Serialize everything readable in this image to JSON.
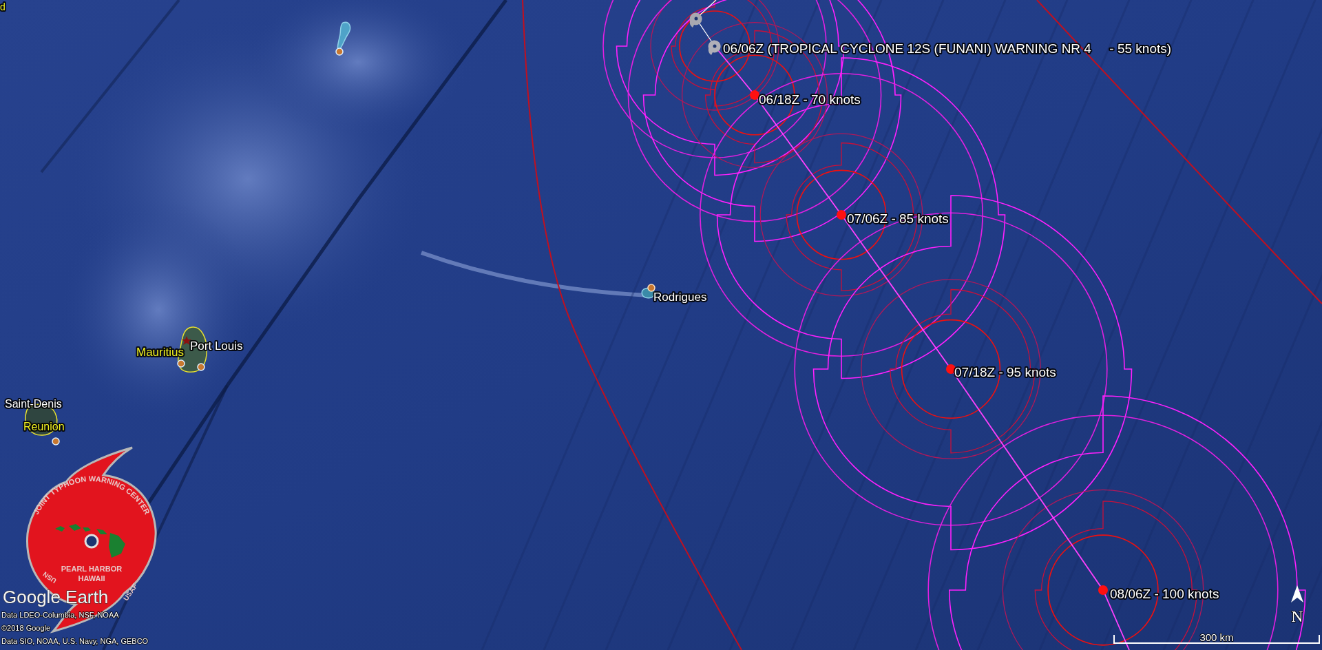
{
  "places": [
    {
      "name": "d",
      "kind": "country"
    },
    {
      "name": "Rodrigues",
      "kind": "city"
    },
    {
      "name": "Port Louis",
      "kind": "city"
    },
    {
      "name": "Mauritius",
      "kind": "country"
    },
    {
      "name": "Saint-Denis",
      "kind": "city"
    },
    {
      "name": "Reunion",
      "kind": "country"
    }
  ],
  "track": [
    {
      "label": "06/06Z (TROPICAL CYCLONE 12S (FUNANI) WARNING NR 4     - 55 knots)",
      "kind": "current"
    },
    {
      "label": "06/18Z - 70 knots",
      "kind": "forecast"
    },
    {
      "label": "07/06Z - 85 knots",
      "kind": "forecast"
    },
    {
      "label": "07/18Z - 95 knots",
      "kind": "forecast"
    },
    {
      "label": "08/06Z - 100 knots",
      "kind": "forecast"
    }
  ],
  "logo": {
    "title": "JOINT TYPHOON WARNING CENTER",
    "location": [
      "PEARL HARBOR",
      "HAWAII"
    ],
    "left_mark": "USN",
    "right_mark": "USAF"
  },
  "brand": "Google Earth",
  "credits": [
    "Data LDEO-Columbia, NSF, NOAA",
    "©2018 Google",
    "Data SIO, NOAA, U.S. Navy, NGA, GEBCO"
  ],
  "scale": "300 km",
  "compass": "N"
}
